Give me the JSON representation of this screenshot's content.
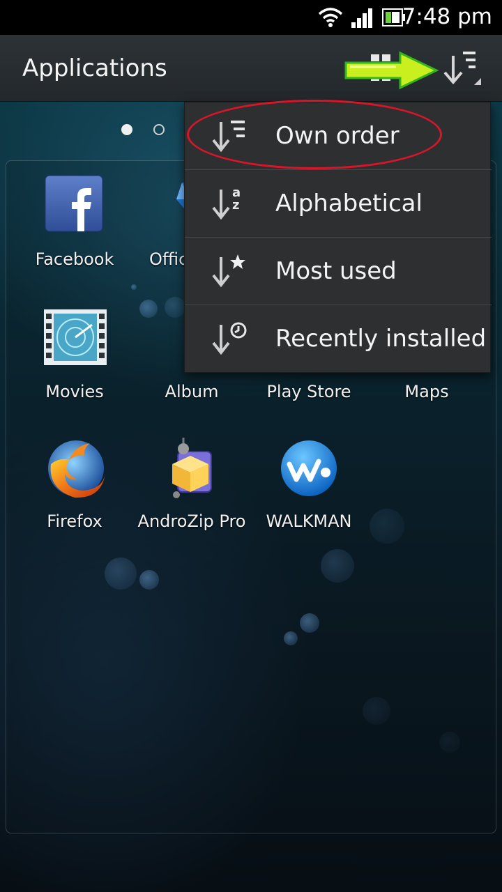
{
  "status_bar": {
    "time": "7:48 pm",
    "icons": [
      "wifi-icon",
      "signal-icon",
      "battery-icon"
    ]
  },
  "action_bar": {
    "title": "Applications",
    "icons": [
      "grid-view-icon",
      "sort-icon"
    ]
  },
  "page_indicator": {
    "pages": 2,
    "current": 1
  },
  "apps": [
    {
      "label": "Facebook",
      "icon": "facebook-icon"
    },
    {
      "label": "Offic",
      "icon": "office-pro-icon"
    },
    {
      "label": "Movies",
      "icon": "movies-icon"
    },
    {
      "label": "Album",
      "icon": "album-icon"
    },
    {
      "label": "Play Store",
      "icon": "play-store-icon"
    },
    {
      "label": "Maps",
      "icon": "maps-icon"
    },
    {
      "label": "Firefox",
      "icon": "firefox-icon"
    },
    {
      "label": "AndroZip Pro",
      "icon": "androzip-icon"
    },
    {
      "label": "WALKMAN",
      "icon": "walkman-icon"
    }
  ],
  "sort_menu": {
    "items": [
      {
        "label": "Own order",
        "icon": "own-order-sort-icon",
        "highlighted": true
      },
      {
        "label": "Alphabetical",
        "icon": "alphabetical-sort-icon"
      },
      {
        "label": "Most used",
        "icon": "most-used-sort-icon"
      },
      {
        "label": "Recently installed",
        "icon": "recently-installed-sort-icon"
      }
    ]
  },
  "annotations": {
    "arrow_color": "#5fdc1e",
    "oval_color": "#d8162a"
  }
}
